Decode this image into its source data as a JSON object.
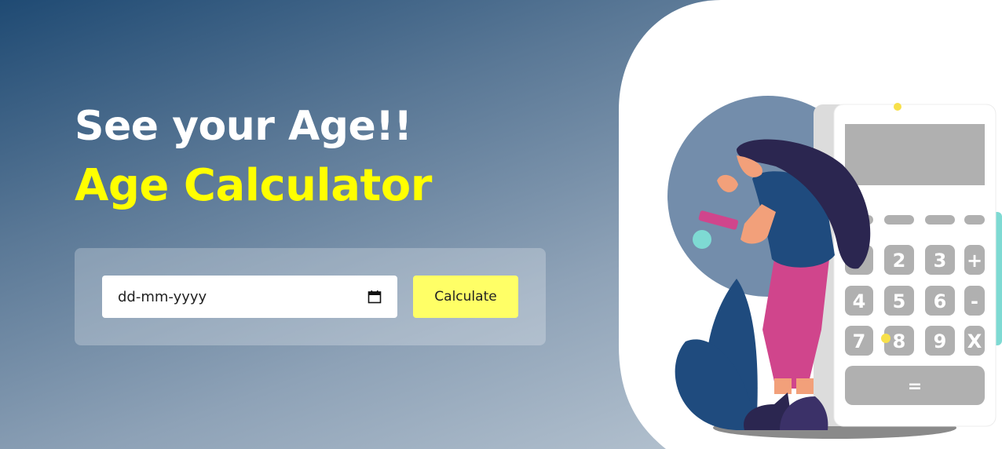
{
  "hero": {
    "title": "See your Age!!",
    "subtitle": "Age Calculator"
  },
  "form": {
    "date_placeholder": "dd-mm-yyyy",
    "date_value": "",
    "calculate_label": "Calculate"
  },
  "illustration": {
    "keys": [
      "2",
      "3",
      "+",
      "4",
      "5",
      "6",
      "-",
      "7",
      "8",
      "9",
      "X",
      "="
    ]
  },
  "colors": {
    "accent_yellow": "#ffff00",
    "button_yellow": "#ffff66",
    "title_white": "#ffffff"
  },
  "icons": [
    "calendar-icon"
  ]
}
